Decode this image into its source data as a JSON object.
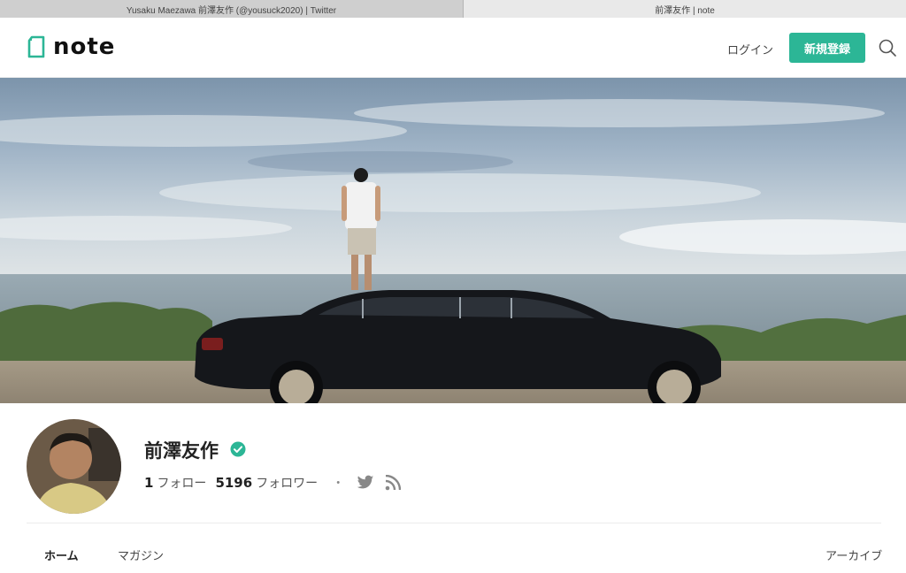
{
  "browser": {
    "tabs": [
      {
        "title": "Yusaku Maezawa 前澤友作 (@yousuck2020) | Twitter"
      },
      {
        "title": "前澤友作 | note"
      }
    ]
  },
  "header": {
    "logo_text": "note",
    "login_label": "ログイン",
    "signup_label": "新規登録"
  },
  "profile": {
    "name": "前澤友作",
    "follow_count": "1",
    "follow_label": "フォロー",
    "follower_count": "5196",
    "follower_label": "フォロワー",
    "separator": "・"
  },
  "tabs": {
    "home": "ホーム",
    "magazine": "マガジン",
    "archive": "アーカイブ"
  },
  "colors": {
    "accent": "#2cb696"
  },
  "icons": [
    "note-logo-icon",
    "search-icon",
    "verified-icon",
    "twitter-icon",
    "rss-icon"
  ]
}
